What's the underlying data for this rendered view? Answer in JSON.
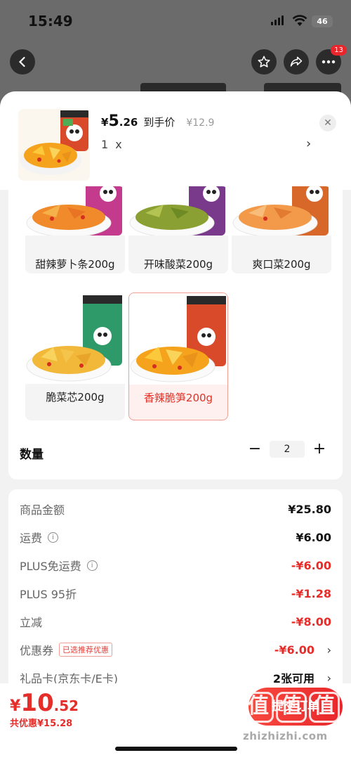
{
  "status_bar": {
    "time": "15:49",
    "battery": "46"
  },
  "header": {
    "more_badge": "13"
  },
  "sku_card": {
    "price_symbol": "¥",
    "price_int": "5",
    "price_dec": ".26",
    "price_label": "到手价",
    "orig_price": "¥12.9",
    "selected_count": "1",
    "selected_times": "x"
  },
  "variants": [
    {
      "label": "甜辣萝卜条200g"
    },
    {
      "label": "开味酸菜200g"
    },
    {
      "label": "爽口菜200g"
    },
    {
      "label": "脆菜芯200g"
    },
    {
      "label": "香辣脆笋200g"
    }
  ],
  "quantity": {
    "title": "数量",
    "minus": "−",
    "value": "2",
    "plus": "+"
  },
  "price_rows": [
    {
      "label": "商品金额",
      "amount": "¥25.80"
    },
    {
      "label": "运费",
      "amount": "¥6.00"
    },
    {
      "label": "PLUS免运费",
      "amount": "-¥6.00"
    },
    {
      "label": "PLUS 95折",
      "amount": "-¥1.28"
    },
    {
      "label": "立减",
      "amount": "-¥8.00"
    },
    {
      "label": "优惠券",
      "tag": "已选推荐优惠",
      "amount": "-¥6.00"
    },
    {
      "label": "礼品卡(京东卡/E卡)",
      "amount": "2张可用"
    }
  ],
  "bottom": {
    "total_symbol": "¥",
    "total_int": "10",
    "total_dec": ".52",
    "saved": "共优惠¥15.28",
    "submit": "提交订单"
  },
  "watermark": {
    "chars": [
      "值",
      "值",
      "值"
    ],
    "url": "zhizhizhi.com"
  },
  "colors": {
    "accent": "#e52d2a",
    "selected_bg": "#fdf0ee"
  }
}
